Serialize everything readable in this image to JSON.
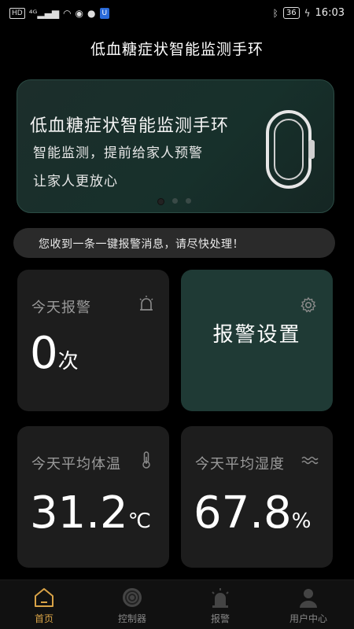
{
  "status_bar": {
    "left_chips": [
      "HD",
      "4G"
    ],
    "time": "16:03",
    "battery": "36"
  },
  "app_title": "低血糖症状智能监测手环",
  "banner": {
    "title": "低血糖症状智能监测手环",
    "line1": "智能监测，提前给家人预警",
    "line2": "让家人更放心",
    "active_dot": 0,
    "dot_count": 3
  },
  "notice": "您收到一条一键报警消息，请尽快处理！",
  "cards": {
    "alarm_today": {
      "label": "今天报警",
      "value": "0",
      "unit": "次",
      "icon": "alarm-icon"
    },
    "alarm_settings": {
      "label": "报警设置",
      "icon": "gear-icon"
    },
    "avg_temp": {
      "label": "今天平均体温",
      "value": "31.2",
      "unit": "℃",
      "icon": "thermometer-icon"
    },
    "avg_humidity": {
      "label": "今天平均湿度",
      "value": "67.8",
      "unit": "%",
      "icon": "waves-icon"
    }
  },
  "tabs": [
    {
      "label": "首页",
      "icon": "home-icon",
      "active": true
    },
    {
      "label": "控制器",
      "icon": "controller-icon",
      "active": false
    },
    {
      "label": "报警",
      "icon": "alarm-light-icon",
      "active": false
    },
    {
      "label": "用户中心",
      "icon": "user-icon",
      "active": false
    }
  ],
  "colors": {
    "accent": "#d9a347",
    "card_teal": "#1f3a35",
    "card_dark": "#1d1d1d"
  }
}
